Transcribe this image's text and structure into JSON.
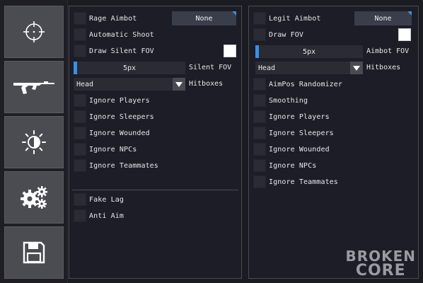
{
  "sidebar": {
    "buttons": [
      {
        "icon": "crosshair-icon"
      },
      {
        "icon": "rifle-icon"
      },
      {
        "icon": "brightness-icon"
      },
      {
        "icon": "gears-icon"
      },
      {
        "icon": "floppy-disk-icon"
      }
    ]
  },
  "left_panel": {
    "rage_aimbot": {
      "label": "Rage Aimbot",
      "keybind": "None"
    },
    "automatic_shoot": "Automatic Shoot",
    "draw_silent_fov": {
      "label": "Draw Silent FOV",
      "color": "#ffffff"
    },
    "silent_fov": {
      "value": "5px",
      "label": "Silent FOV",
      "fill": 0.03
    },
    "hitboxes": {
      "value": "Head",
      "label": "Hitboxes"
    },
    "ignore_players": "Ignore Players",
    "ignore_sleepers": "Ignore Sleepers",
    "ignore_wounded": "Ignore Wounded",
    "ignore_npcs": "Ignore NPCs",
    "ignore_teammates": "Ignore Teammates",
    "fake_lag": "Fake Lag",
    "anti_aim": "Anti Aim"
  },
  "right_panel": {
    "legit_aimbot": {
      "label": "Legit Aimbot",
      "keybind": "None"
    },
    "draw_fov": {
      "label": "Draw FOV",
      "color": "#ffffff"
    },
    "aimbot_fov": {
      "value": "5px",
      "label": "Aimbot FOV",
      "fill": 0.03
    },
    "hitboxes": {
      "value": "Head",
      "label": "Hitboxes"
    },
    "aimpos_randomizer": "AimPos Randomizer",
    "smoothing": "Smoothing",
    "ignore_players": "Ignore Players",
    "ignore_sleepers": "Ignore Sleepers",
    "ignore_wounded": "Ignore Wounded",
    "ignore_npcs": "Ignore NPCs",
    "ignore_teammates": "Ignore Teammates"
  },
  "logo": {
    "line1": "BROKEN",
    "line2": "CORE"
  },
  "colors": {
    "accent": "#3a8fe6",
    "panel_border": "#4a4a52",
    "sidebar_button": "#4b4b52"
  }
}
